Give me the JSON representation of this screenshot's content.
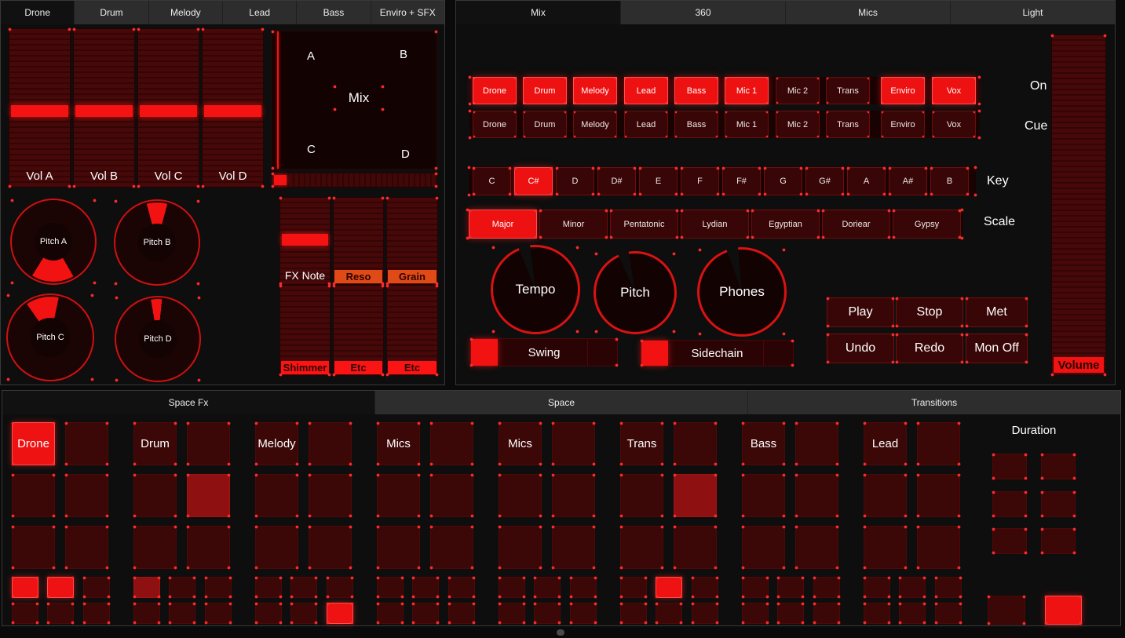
{
  "colors": {
    "accent_on": "#ee1111",
    "pad_off": "#3c0707",
    "pad_mid": "#8e1010",
    "tag_orange": "#e04a16",
    "tag_red": "#fa1414"
  },
  "left_panel": {
    "tabs": [
      {
        "label": "Drone",
        "active": true
      },
      {
        "label": "Drum"
      },
      {
        "label": "Melody"
      },
      {
        "label": "Lead"
      },
      {
        "label": "Bass"
      },
      {
        "label": "Enviro + SFX"
      }
    ],
    "volume_faders": [
      {
        "label": "Vol A"
      },
      {
        "label": "Vol B"
      },
      {
        "label": "Vol C"
      },
      {
        "label": "Vol D"
      }
    ],
    "xy_pad": {
      "label": "Mix",
      "corner_a": "A",
      "corner_b": "B",
      "corner_c": "C",
      "corner_d": "D"
    },
    "pitch_knobs": [
      {
        "label": "Pitch A",
        "wedge_from": 150,
        "wedge_to": 212
      },
      {
        "label": "Pitch B",
        "wedge_from": -15,
        "wedge_to": 15
      },
      {
        "label": "Pitch C",
        "wedge_from": -35,
        "wedge_to": 12
      },
      {
        "label": "Pitch D",
        "wedge_from": -10,
        "wedge_to": 6
      }
    ],
    "fx_faders": [
      {
        "label": "FX Note",
        "style": "plain",
        "handle": true
      },
      {
        "label": "Reso",
        "style": "tag",
        "color": "#e04a16"
      },
      {
        "label": "Grain",
        "style": "tag",
        "color": "#e04a16"
      },
      {
        "label": "Shimmer",
        "style": "tag",
        "color": "#fa1414"
      },
      {
        "label": "Etc",
        "style": "tag",
        "color": "#fa1414"
      },
      {
        "label": "Etc",
        "style": "tag",
        "color": "#fa1414"
      }
    ]
  },
  "right_panel": {
    "tabs": [
      {
        "label": "Mix",
        "active": true
      },
      {
        "label": "360"
      },
      {
        "label": "Mics"
      },
      {
        "label": "Light"
      }
    ],
    "track_buttons_row1": [
      {
        "label": "Drone",
        "on": true
      },
      {
        "label": "Drum",
        "on": true
      },
      {
        "label": "Melody",
        "on": true
      },
      {
        "label": "Lead",
        "on": true
      },
      {
        "label": "Bass",
        "on": true
      },
      {
        "label": "Mic 1",
        "on": true
      },
      {
        "label": "Mic 2",
        "on": false
      },
      {
        "label": "Trans",
        "on": false
      },
      {
        "label": "Enviro",
        "on": true
      },
      {
        "label": "Vox",
        "on": true
      }
    ],
    "track_buttons_row2": [
      {
        "label": "Drone"
      },
      {
        "label": "Drum"
      },
      {
        "label": "Melody"
      },
      {
        "label": "Lead"
      },
      {
        "label": "Bass"
      },
      {
        "label": "Mic 1"
      },
      {
        "label": "Mic 2"
      },
      {
        "label": "Trans"
      },
      {
        "label": "Enviro"
      },
      {
        "label": "Vox"
      }
    ],
    "key_row": {
      "label": "Key",
      "notes": [
        {
          "label": "C"
        },
        {
          "label": "C#",
          "on": true
        },
        {
          "label": "D"
        },
        {
          "label": "D#"
        },
        {
          "label": "E"
        },
        {
          "label": "F"
        },
        {
          "label": "F#"
        },
        {
          "label": "G"
        },
        {
          "label": "G#"
        },
        {
          "label": "A"
        },
        {
          "label": "A#"
        },
        {
          "label": "B"
        }
      ]
    },
    "scale_row": {
      "label": "Scale",
      "scales": [
        {
          "label": "Major",
          "on": true
        },
        {
          "label": "Minor"
        },
        {
          "label": "Pentatonic"
        },
        {
          "label": "Lydian"
        },
        {
          "label": "Egyptian"
        },
        {
          "label": "Doriear"
        },
        {
          "label": "Gypsy"
        }
      ]
    },
    "knobs": [
      {
        "label": "Tempo"
      },
      {
        "label": "Pitch"
      },
      {
        "label": "Phones"
      }
    ],
    "toggles": [
      {
        "label": "Swing",
        "on": true
      },
      {
        "label": "Sidechain",
        "on": true
      }
    ],
    "transport": [
      {
        "label": "Play"
      },
      {
        "label": "Stop"
      },
      {
        "label": "Met"
      },
      {
        "label": "Undo"
      },
      {
        "label": "Redo"
      },
      {
        "label": "Mon Off"
      }
    ],
    "monitor": {
      "on_label": "On",
      "cue_label": "Cue"
    },
    "volume_fader": {
      "label": "Volume"
    }
  },
  "bottom_panel": {
    "tabs": [
      {
        "label": "Space Fx",
        "active": true
      },
      {
        "label": "Space"
      },
      {
        "label": "Transitions"
      }
    ],
    "pad_groups": [
      {
        "name": "Drone",
        "big": [
          "on",
          "off",
          "off",
          "off",
          "off",
          "off"
        ],
        "small": [
          "on",
          "on",
          "off",
          "off",
          "off",
          "off"
        ]
      },
      {
        "name": "Drum",
        "big": [
          "off",
          "off",
          "off",
          "mid",
          "off",
          "off"
        ],
        "small": [
          "mid",
          "off",
          "off",
          "off",
          "off",
          "off"
        ]
      },
      {
        "name": "Melody",
        "big": [
          "off",
          "off",
          "off",
          "off",
          "off",
          "off"
        ],
        "small": [
          "off",
          "off",
          "off",
          "off",
          "off",
          "on"
        ]
      },
      {
        "name": "Mics",
        "big": [
          "off",
          "off",
          "off",
          "off",
          "off",
          "off"
        ],
        "small": [
          "off",
          "off",
          "off",
          "off",
          "off",
          "off"
        ]
      },
      {
        "name": "Mics",
        "big": [
          "off",
          "off",
          "off",
          "off",
          "off",
          "off"
        ],
        "small": [
          "off",
          "off",
          "off",
          "off",
          "off",
          "off"
        ]
      },
      {
        "name": "Trans",
        "big": [
          "off",
          "off",
          "off",
          "mid",
          "off",
          "off"
        ],
        "small": [
          "off",
          "on",
          "off",
          "off",
          "off",
          "off"
        ]
      },
      {
        "name": "Bass",
        "big": [
          "off",
          "off",
          "off",
          "off",
          "off",
          "off"
        ],
        "small": [
          "off",
          "off",
          "off",
          "off",
          "off",
          "off"
        ]
      },
      {
        "name": "Lead",
        "big": [
          "off",
          "off",
          "off",
          "off",
          "off",
          "off"
        ],
        "small": [
          "off",
          "off",
          "off",
          "off",
          "off",
          "off"
        ]
      }
    ],
    "duration_group": {
      "label": "Duration",
      "pads": [
        "off",
        "off",
        "off",
        "off",
        "off",
        "off"
      ],
      "bottom_pads": [
        "off",
        "on"
      ]
    }
  }
}
